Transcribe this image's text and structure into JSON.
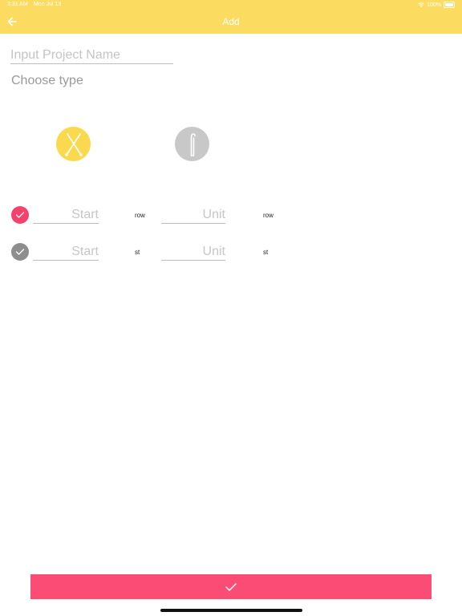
{
  "status_bar": {
    "time": "3:31 AM",
    "date": "Mon Jul 13",
    "battery": "100%"
  },
  "nav": {
    "title": "Add",
    "back_icon": "arrow-left-icon"
  },
  "form": {
    "name_placeholder": "Input Project Name",
    "choose_type_label": "Choose type",
    "types": [
      {
        "icon": "knitting-needles-icon",
        "selected": true
      },
      {
        "icon": "crochet-hook-icon",
        "selected": false
      }
    ],
    "counters": [
      {
        "checked": true,
        "start_placeholder": "Start",
        "start_unit": "row",
        "unit_placeholder": "Unit",
        "unit_unit": "row"
      },
      {
        "checked": false,
        "start_placeholder": "Start",
        "start_unit": "st",
        "unit_placeholder": "Unit",
        "unit_unit": "st"
      }
    ]
  },
  "confirm": {
    "icon": "checkmark-icon"
  },
  "colors": {
    "header": "#fbdc61",
    "accent": "#fb4c75",
    "check_on": "#f6416c",
    "check_off": "#8d8d8d",
    "type_selected": "#fbd94f",
    "type_unselected": "#c8c8c8"
  }
}
